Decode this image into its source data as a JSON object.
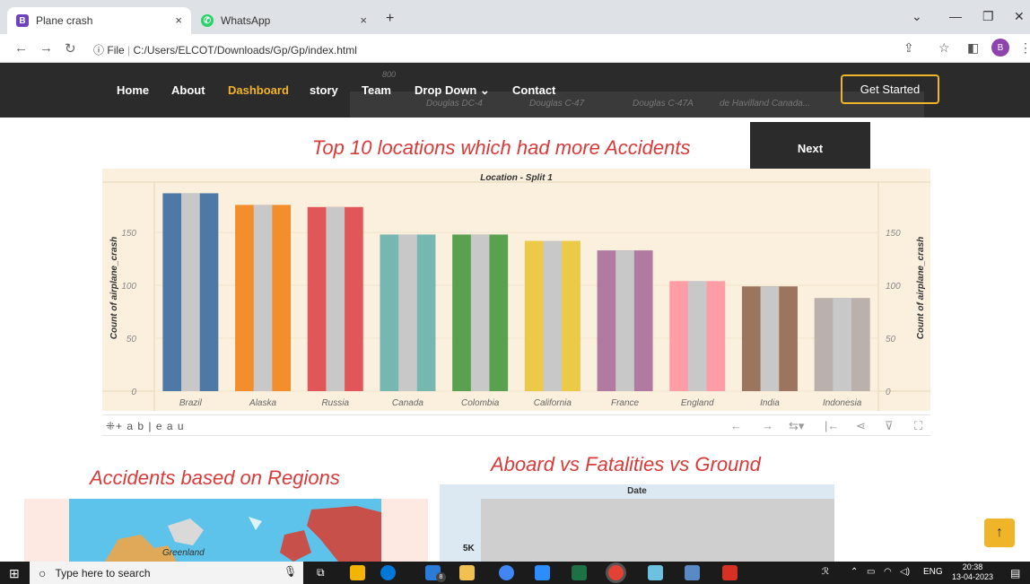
{
  "browser": {
    "tabs": [
      {
        "title": "Plane crash",
        "icon": "B",
        "icon_color": "#6f42c1",
        "close": "×"
      },
      {
        "title": "WhatsApp",
        "icon": "✆",
        "icon_color": "#25d366",
        "close": "×"
      }
    ],
    "new_tab": "+",
    "url_prefix": "File",
    "url": "C:/Users/ELCOT/Downloads/Gp/Gp/index.html",
    "profile_initial": "B"
  },
  "site_nav": {
    "links": [
      "Home",
      "About",
      "Dashboard",
      "story",
      "Team",
      "Drop Down ⌄",
      "Contact"
    ],
    "active": "Dashboard",
    "cta": "Get Started",
    "accent": "#f0b429"
  },
  "bleed_labels": {
    "number": "800",
    "categories": [
      "Douglas DC-4",
      "Douglas C-47",
      "Douglas C-47A",
      "de Havilland Canada..."
    ]
  },
  "section1": {
    "title": "Top 10 locations which had more Accidents",
    "next": "Next"
  },
  "tableau": {
    "logo": "⁜+ a b | e a u",
    "chart_data": {
      "type": "bar",
      "title": "Location - Split 1",
      "ylabel": "Count of airplane_crash",
      "categories": [
        "Brazil",
        "Alaska",
        "Russia",
        "Canada",
        "Colombia",
        "California",
        "France",
        "England",
        "India",
        "Indonesia"
      ],
      "values": [
        187,
        176,
        174,
        148,
        148,
        142,
        133,
        104,
        99,
        88
      ],
      "colors": [
        "#4e79a7",
        "#f28e2b",
        "#e15759",
        "#76b7b2",
        "#59a14f",
        "#edc948",
        "#b07aa1",
        "#ff9da7",
        "#9c755f",
        "#bab0ac"
      ],
      "overlay_color": "#c8c8c8",
      "yticks": [
        0,
        50,
        100,
        150
      ],
      "ylim": [
        0,
        195
      ]
    }
  },
  "section2": {
    "title": "Accidents  based on Regions",
    "map_label": "Greenland"
  },
  "section3": {
    "title": "Aboard vs Fatalities vs Ground",
    "header": "Date",
    "tick": "5K"
  },
  "scroll_top": "↑",
  "taskbar": {
    "search_placeholder": "Type here to search",
    "lang": "ENG",
    "time": "20:38",
    "date": "13-04-2023",
    "notif": "8"
  }
}
